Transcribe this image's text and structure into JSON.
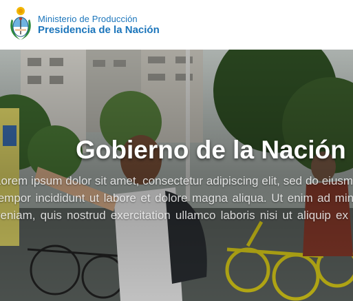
{
  "header": {
    "ministry": "Ministerio de Producción",
    "presidency": "Presidencia de la Nación"
  },
  "hero": {
    "title": "Gobierno de la Nación",
    "text": "Lorem ipsum dolor sit amet, consectetur adipiscing elit, sed do eiusmod tempor incididunt ut labore et dolore magna aliqua. Ut enim ad minim veniam, quis nostrud exercitation ullamco laboris nisi ut aliquip ex ea commodo consequat."
  },
  "colors": {
    "brand": "#1b75bb",
    "hero_text": "#ffffff"
  }
}
